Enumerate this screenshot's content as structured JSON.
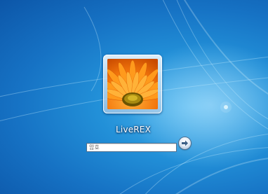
{
  "login": {
    "username": "LiveREX",
    "password": {
      "value": "",
      "placeholder": "암호"
    }
  },
  "icons": {
    "avatar": "orange-gerbera-flower",
    "submit": "arrow-right-icon"
  },
  "colors": {
    "background": "#1a7fd0",
    "avatar_petals": "#f7850f",
    "avatar_center": "#8a6b00"
  }
}
